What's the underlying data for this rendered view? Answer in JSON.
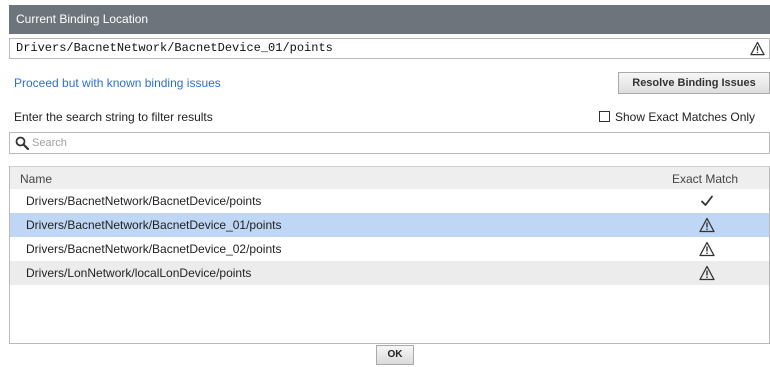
{
  "dialog": {
    "title": "Current Binding Location",
    "location_value": "Drivers/BacnetNetwork/BacnetDevice_01/points",
    "location_status_icon": "warning-icon"
  },
  "actions": {
    "proceed_link": "Proceed but with known binding issues",
    "resolve_button": "Resolve Binding Issues",
    "ok_button": "OK"
  },
  "filter": {
    "label": "Enter the search string to filter results",
    "exact_only_label": "Show Exact Matches Only",
    "exact_only_checked": false,
    "search_placeholder": "Search",
    "search_value": ""
  },
  "table": {
    "columns": [
      "Name",
      "Exact Match"
    ],
    "rows": [
      {
        "name": "Drivers/BacnetNetwork/BacnetDevice/points",
        "exact_icon": "checkmark-icon",
        "selected": false
      },
      {
        "name": "Drivers/BacnetNetwork/BacnetDevice_01/points",
        "exact_icon": "warning-icon",
        "selected": true
      },
      {
        "name": "Drivers/BacnetNetwork/BacnetDevice_02/points",
        "exact_icon": "warning-icon",
        "selected": false
      },
      {
        "name": "Drivers/LonNetwork/localLonDevice/points",
        "exact_icon": "warning-icon",
        "selected": false
      }
    ]
  },
  "colors": {
    "titlebar": "#6d747b",
    "link": "#2d6fd0",
    "selected_row": "#bfd6f4"
  }
}
